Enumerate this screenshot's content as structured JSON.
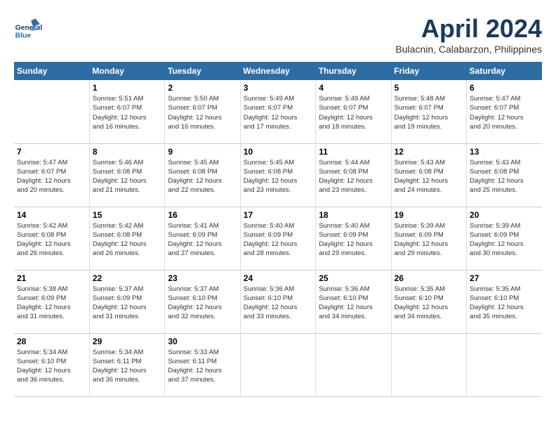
{
  "header": {
    "logo_general": "General",
    "logo_blue": "Blue",
    "month_title": "April 2024",
    "location": "Bulacnin, Calabarzon, Philippines"
  },
  "days_of_week": [
    "Sunday",
    "Monday",
    "Tuesday",
    "Wednesday",
    "Thursday",
    "Friday",
    "Saturday"
  ],
  "weeks": [
    [
      {
        "day": "",
        "info": ""
      },
      {
        "day": "1",
        "info": "Sunrise: 5:51 AM\nSunset: 6:07 PM\nDaylight: 12 hours\nand 16 minutes."
      },
      {
        "day": "2",
        "info": "Sunrise: 5:50 AM\nSunset: 6:07 PM\nDaylight: 12 hours\nand 16 minutes."
      },
      {
        "day": "3",
        "info": "Sunrise: 5:49 AM\nSunset: 6:07 PM\nDaylight: 12 hours\nand 17 minutes."
      },
      {
        "day": "4",
        "info": "Sunrise: 5:49 AM\nSunset: 6:07 PM\nDaylight: 12 hours\nand 18 minutes."
      },
      {
        "day": "5",
        "info": "Sunrise: 5:48 AM\nSunset: 6:07 PM\nDaylight: 12 hours\nand 19 minutes."
      },
      {
        "day": "6",
        "info": "Sunrise: 5:47 AM\nSunset: 6:07 PM\nDaylight: 12 hours\nand 20 minutes."
      }
    ],
    [
      {
        "day": "7",
        "info": "Sunrise: 5:47 AM\nSunset: 6:07 PM\nDaylight: 12 hours\nand 20 minutes."
      },
      {
        "day": "8",
        "info": "Sunrise: 5:46 AM\nSunset: 6:08 PM\nDaylight: 12 hours\nand 21 minutes."
      },
      {
        "day": "9",
        "info": "Sunrise: 5:45 AM\nSunset: 6:08 PM\nDaylight: 12 hours\nand 22 minutes."
      },
      {
        "day": "10",
        "info": "Sunrise: 5:45 AM\nSunset: 6:08 PM\nDaylight: 12 hours\nand 23 minutes."
      },
      {
        "day": "11",
        "info": "Sunrise: 5:44 AM\nSunset: 6:08 PM\nDaylight: 12 hours\nand 23 minutes."
      },
      {
        "day": "12",
        "info": "Sunrise: 5:43 AM\nSunset: 6:08 PM\nDaylight: 12 hours\nand 24 minutes."
      },
      {
        "day": "13",
        "info": "Sunrise: 5:43 AM\nSunset: 6:08 PM\nDaylight: 12 hours\nand 25 minutes."
      }
    ],
    [
      {
        "day": "14",
        "info": "Sunrise: 5:42 AM\nSunset: 6:08 PM\nDaylight: 12 hours\nand 26 minutes."
      },
      {
        "day": "15",
        "info": "Sunrise: 5:42 AM\nSunset: 6:08 PM\nDaylight: 12 hours\nand 26 minutes."
      },
      {
        "day": "16",
        "info": "Sunrise: 5:41 AM\nSunset: 6:09 PM\nDaylight: 12 hours\nand 27 minutes."
      },
      {
        "day": "17",
        "info": "Sunrise: 5:40 AM\nSunset: 6:09 PM\nDaylight: 12 hours\nand 28 minutes."
      },
      {
        "day": "18",
        "info": "Sunrise: 5:40 AM\nSunset: 6:09 PM\nDaylight: 12 hours\nand 29 minutes."
      },
      {
        "day": "19",
        "info": "Sunrise: 5:39 AM\nSunset: 6:09 PM\nDaylight: 12 hours\nand 29 minutes."
      },
      {
        "day": "20",
        "info": "Sunrise: 5:39 AM\nSunset: 6:09 PM\nDaylight: 12 hours\nand 30 minutes."
      }
    ],
    [
      {
        "day": "21",
        "info": "Sunrise: 5:38 AM\nSunset: 6:09 PM\nDaylight: 12 hours\nand 31 minutes."
      },
      {
        "day": "22",
        "info": "Sunrise: 5:37 AM\nSunset: 6:09 PM\nDaylight: 12 hours\nand 31 minutes."
      },
      {
        "day": "23",
        "info": "Sunrise: 5:37 AM\nSunset: 6:10 PM\nDaylight: 12 hours\nand 32 minutes."
      },
      {
        "day": "24",
        "info": "Sunrise: 5:36 AM\nSunset: 6:10 PM\nDaylight: 12 hours\nand 33 minutes."
      },
      {
        "day": "25",
        "info": "Sunrise: 5:36 AM\nSunset: 6:10 PM\nDaylight: 12 hours\nand 34 minutes."
      },
      {
        "day": "26",
        "info": "Sunrise: 5:35 AM\nSunset: 6:10 PM\nDaylight: 12 hours\nand 34 minutes."
      },
      {
        "day": "27",
        "info": "Sunrise: 5:35 AM\nSunset: 6:10 PM\nDaylight: 12 hours\nand 35 minutes."
      }
    ],
    [
      {
        "day": "28",
        "info": "Sunrise: 5:34 AM\nSunset: 6:10 PM\nDaylight: 12 hours\nand 36 minutes."
      },
      {
        "day": "29",
        "info": "Sunrise: 5:34 AM\nSunset: 6:11 PM\nDaylight: 12 hours\nand 36 minutes."
      },
      {
        "day": "30",
        "info": "Sunrise: 5:33 AM\nSunset: 6:11 PM\nDaylight: 12 hours\nand 37 minutes."
      },
      {
        "day": "",
        "info": ""
      },
      {
        "day": "",
        "info": ""
      },
      {
        "day": "",
        "info": ""
      },
      {
        "day": "",
        "info": ""
      }
    ]
  ]
}
